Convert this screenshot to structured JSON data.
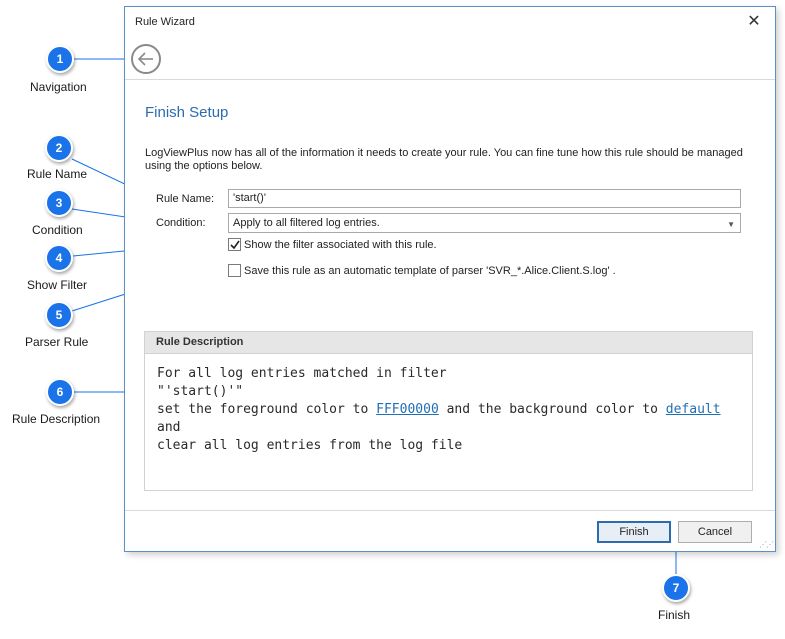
{
  "dialog": {
    "title": "Rule Wizard",
    "close_glyph": "✕",
    "heading": "Finish Setup",
    "intro": "LogViewPlus now has all of the information it needs to create your rule.  You can fine tune how this rule should be managed using the options below.",
    "rule_name_label": "Rule Name:",
    "rule_name_value": "'start()'",
    "condition_label": "Condition:",
    "condition_value": "Apply to all filtered log entries.",
    "show_filter_label": "Show the filter associated with this rule.",
    "show_filter_checked": true,
    "save_template_label": "Save this rule as an automatic template of parser 'SVR_*.Alice.Client.S.log' .",
    "save_template_checked": false,
    "description_header": "Rule Description",
    "description": {
      "line1": "For all log entries matched in filter",
      "line2": "\"'start()'\"",
      "line3_pre": "set the foreground color to ",
      "line3_fg": "FFF00000",
      "line3_mid": " and the background color to ",
      "line3_bg": "default",
      "line4": "and",
      "line5": "clear all log entries from the log file"
    },
    "finish_label": "Finish",
    "cancel_label": "Cancel"
  },
  "callouts": [
    {
      "num": "1",
      "label": "Navigation"
    },
    {
      "num": "2",
      "label": "Rule Name"
    },
    {
      "num": "3",
      "label": "Condition"
    },
    {
      "num": "4",
      "label": "Show Filter"
    },
    {
      "num": "5",
      "label": "Parser Rule"
    },
    {
      "num": "6",
      "label": "Rule Description"
    },
    {
      "num": "7",
      "label": "Finish"
    }
  ],
  "icons": {
    "back": "back-arrow-icon",
    "check": "checkmark-icon",
    "dropdown": "chevron-down-icon",
    "grip": "resize-grip-icon"
  },
  "colors": {
    "accent": "#2b6cb0",
    "callout": "#1a73e8",
    "link": "#1f6fb5"
  }
}
